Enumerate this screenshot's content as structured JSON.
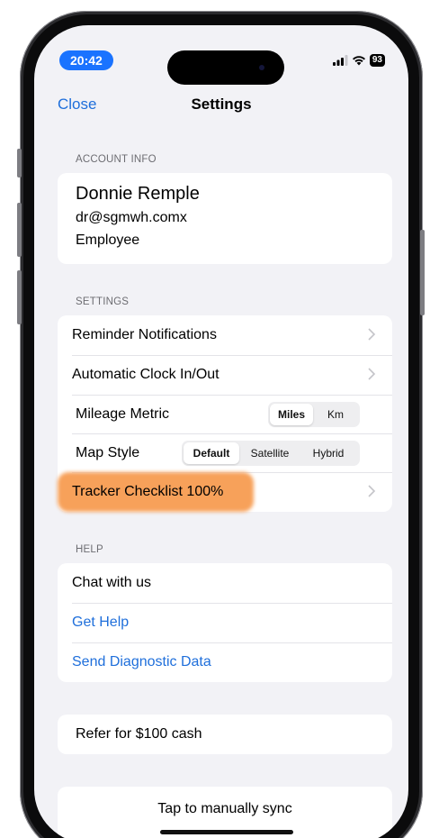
{
  "status_bar": {
    "time": "20:42",
    "battery": "93"
  },
  "nav": {
    "close_label": "Close",
    "title": "Settings"
  },
  "account": {
    "header": "ACCOUNT INFO",
    "name": "Donnie Remple",
    "email": "dr@sgmwh.comx",
    "role": "Employee"
  },
  "settings": {
    "header": "SETTINGS",
    "reminder_label": "Reminder Notifications",
    "clock_label": "Automatic Clock In/Out",
    "mileage_label": "Mileage Metric",
    "mileage_options": [
      "Miles",
      "Km"
    ],
    "mileage_selected": "Miles",
    "map_label": "Map Style",
    "map_options": [
      "Default",
      "Satellite",
      "Hybrid"
    ],
    "map_selected": "Default",
    "tracker_label": "Tracker Checklist 100%",
    "highlight_color": "#f7a15a"
  },
  "help": {
    "header": "HELP",
    "chat_label": "Chat with us",
    "get_help_label": "Get Help",
    "diagnostic_label": "Send Diagnostic Data"
  },
  "refer": {
    "label": "Refer for $100 cash"
  },
  "sync": {
    "label": "Tap to manually sync"
  },
  "colors": {
    "accent": "#1f6fdb",
    "status_pill": "#1a73ff",
    "background": "#f2f2f6"
  }
}
